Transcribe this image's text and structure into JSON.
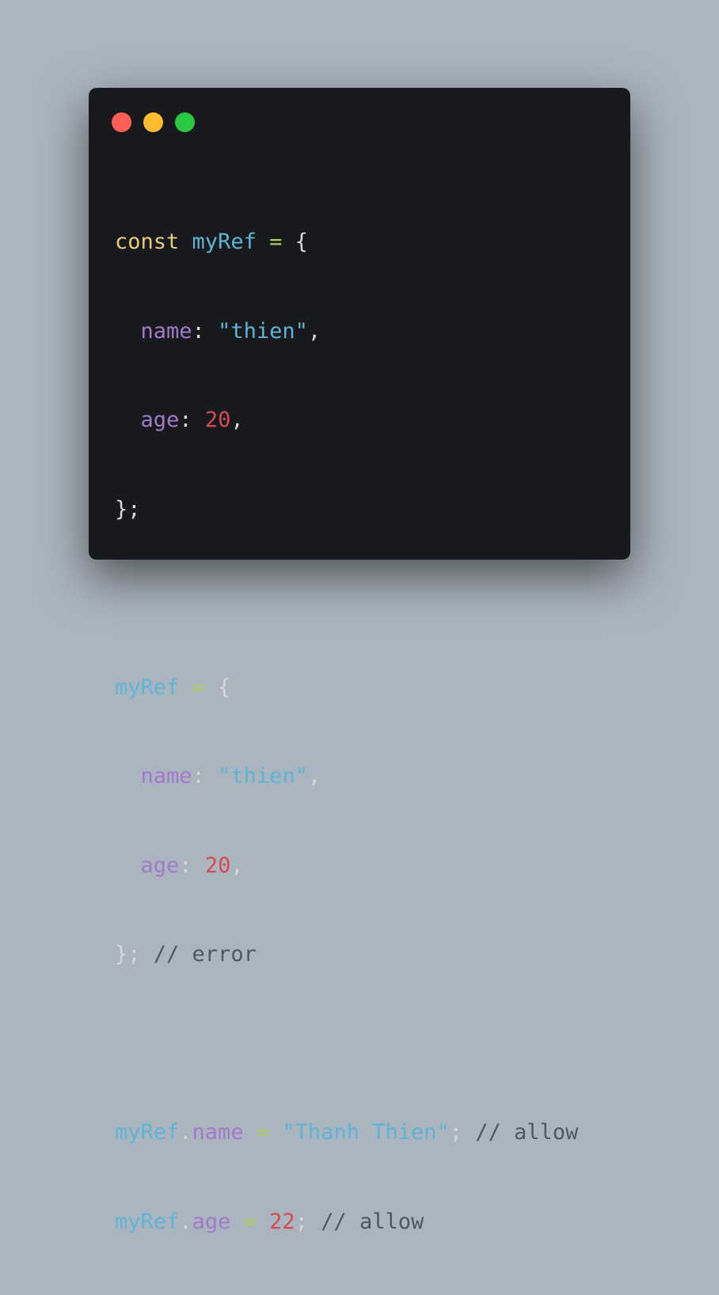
{
  "window": {
    "controls": [
      {
        "name": "close",
        "color": "#ff5f57"
      },
      {
        "name": "minimize",
        "color": "#febc2e"
      },
      {
        "name": "zoom",
        "color": "#28c840"
      }
    ]
  },
  "colors": {
    "background": "#abb5bf",
    "window": "#17191c",
    "keyword": "#e6cc7b",
    "identifier": "#5fb4d6",
    "operator": "#a9d05c",
    "property": "#a379c9",
    "string": "#5fb4d6",
    "number": "#d64a52",
    "punctuation": "#d8d8d8",
    "comment": "#4c5863"
  },
  "code": {
    "l1": {
      "kw": "const",
      "id": "myRef",
      "op": "=",
      "brace": "{"
    },
    "l2": {
      "prop": "name",
      "colon": ":",
      "str": "\"thien\"",
      "comma": ","
    },
    "l3": {
      "prop": "age",
      "colon": ":",
      "num": "20",
      "comma": ","
    },
    "l4": {
      "close": "};"
    },
    "l6": {
      "id": "myRef",
      "op": "=",
      "brace": "{"
    },
    "l7": {
      "prop": "name",
      "colon": ":",
      "str": "\"thien\"",
      "comma": ","
    },
    "l8": {
      "prop": "age",
      "colon": ":",
      "num": "20",
      "comma": ","
    },
    "l9": {
      "close": "};",
      "comment": "// error"
    },
    "l11": {
      "id": "myRef",
      "dot": ".",
      "prop": "name",
      "op": "=",
      "str": "\"Thanh Thien\"",
      "semi": ";",
      "comment": "// allow"
    },
    "l12": {
      "id": "myRef",
      "dot": ".",
      "prop": "age",
      "op": "=",
      "num": "22",
      "semi": ";",
      "comment": "// allow"
    }
  }
}
